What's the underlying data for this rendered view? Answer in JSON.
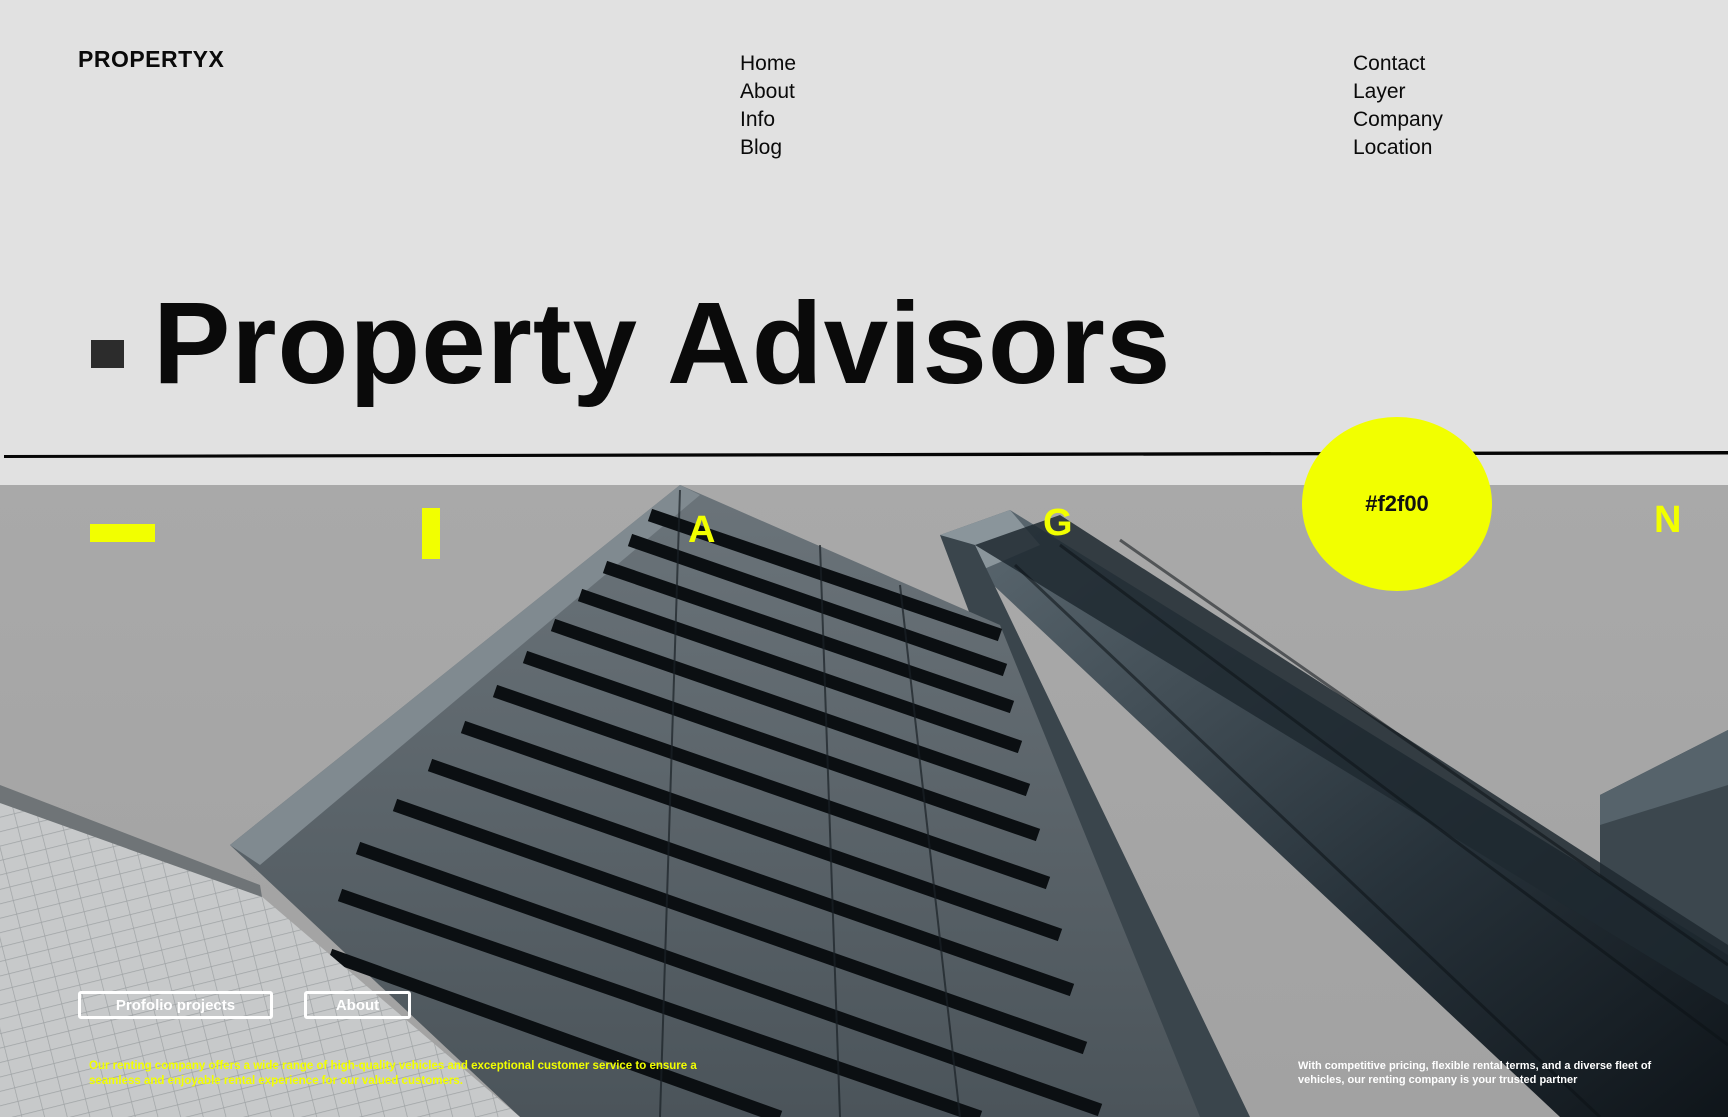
{
  "brand": {
    "logo": "PROPERTYX"
  },
  "nav": {
    "col1": [
      "Home",
      "About",
      "Info",
      "Blog"
    ],
    "col2": [
      "Contact",
      "Layer",
      "Company",
      "Location"
    ]
  },
  "hero": {
    "title": "Property Advisors"
  },
  "accents": {
    "letters": [
      "A",
      "G",
      "N"
    ],
    "circle_label": "#f2f00",
    "accent_color": "#f2ff00"
  },
  "buttons": {
    "portfolio": "Profolio projects",
    "about": "About"
  },
  "footer": {
    "left_text": "Our renting company offers a wide range of high-quality vehicles and exceptional customer service to ensure a seamless and enjoyable rental experience for our valued customers.",
    "right_text": "With competitive pricing, flexible rental terms, and a diverse fleet of vehicles, our renting company is your trusted partner"
  }
}
